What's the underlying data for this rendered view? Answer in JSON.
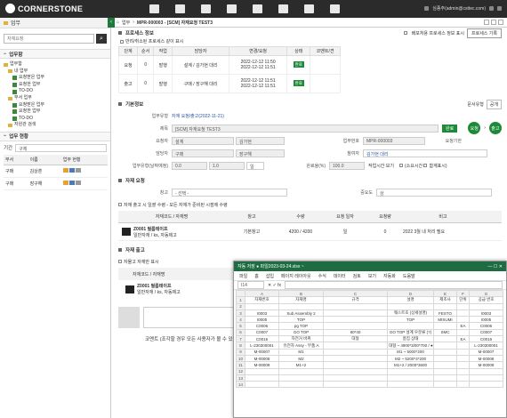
{
  "app": {
    "brand": "CORNERSTONE",
    "user": "심종주(admin@csttec.com)"
  },
  "left": {
    "title": "업무",
    "search_placeholder": "자재요청",
    "section1": "업무함",
    "tree": [
      "업무함",
      "내 업무",
      "요청받은 업무",
      "요청한 업무",
      "TO-DO",
      "부서 업무",
      "요청받은 업무",
      "요청한 업무",
      "TO-DO",
      "자원관 검색"
    ],
    "section2": "업무 현황",
    "filter_label": "기간",
    "filter_value": "구체",
    "col_dept": "부서",
    "col_name": "이름",
    "col_status": "업무 현황",
    "rows": [
      {
        "dept": "구매",
        "name": "김상훈"
      },
      {
        "dept": "구매",
        "name": "장구해"
      }
    ]
  },
  "main": {
    "crumb": "업무",
    "title": "MPR-000003 - [SCM] 자재요청 TEST3",
    "flow": {
      "title": "프로세스 정보",
      "opt": "반려/취소된 프로세스 같이 표시",
      "opt2": "배포처용 프로세스 정보 표시",
      "btn": "프로세스 기록",
      "cols": [
        "단계",
        "순서",
        "작업",
        "담당자",
        "변경/요청",
        "상태",
        "코멘트/견"
      ],
      "rows": [
        {
          "stage": "요청",
          "ord": "0",
          "task": "발행",
          "who": "설계 / 김가현 대리",
          "dates": [
            "2022-12-12 11:50",
            "2022-12-12 11:51"
          ],
          "status": "완료"
        },
        {
          "stage": "출고",
          "ord": "0",
          "task": "발행",
          "who": "구매 / 장구해 대리",
          "dates": [
            "2022-12-12 11:51",
            "2022-12-12 11:51"
          ],
          "status": "완료"
        }
      ]
    },
    "basic": {
      "title": "기본정보",
      "right_label": "문서유형",
      "right_val": "공개",
      "type_label": "업무유형",
      "type_val": "자재 요청/출고(2022-11-21)",
      "subject_label": "제목",
      "subject_val": "[SCM] 자재요청 TEST3",
      "btn": "완료",
      "c1": "요청",
      "c2": "출고",
      "req_label": "요청자",
      "req1": "설계",
      "req2": "김가현",
      "biz_label": "업무번호",
      "biz_val": "MPR-000003",
      "due_label": "요청기한",
      "mgr_label": "담당자",
      "mgr1": "구매",
      "mgr2": "장구해",
      "ref_label": "참여자",
      "ref_val": "김가현 대리",
      "eff_label": "업무유형(날짜예정)",
      "eff1": "0.0",
      "eff2": "1.0",
      "eff3": "일",
      "pct_label": "완료율(%)",
      "pct_val": "100.0",
      "pct_note": "작업시간 보기",
      "ck1": "(소요시간",
      "ck2": "합계표시)"
    },
    "req": {
      "title": "자재 요청",
      "wh_label": "창고",
      "wh_val": "- 선택 -",
      "pri_label": "중요도",
      "pri_val": "상",
      "note": "자재 출고 시 일괄 수령 - 모든 자재가 준비된 시점에 수령",
      "cols": [
        "자재코드 / 자재명",
        "창고",
        "수량",
        "요청 일자",
        "요청량",
        "비고"
      ],
      "item_code": "Z0001 필름테이프",
      "item_sub": "일반자재 / ks, 자동제고",
      "item_wh": "기본창고",
      "item_qty": "4200 / 4200",
      "item_day": "일",
      "item_amt": "0",
      "item_note": "2022 3월 내 처리 필요"
    },
    "out": {
      "title": "자재 출고",
      "opt": "자물고 자재만 표시",
      "cols": [
        "자재코드 / 자재명"
      ],
      "item_code": "Z0001 필름테이프",
      "item_sub": "일반자재 / ks, 자동제고",
      "comment": "코멘트 (조각할 경우 모든 사용자가 볼 수 있음)"
    }
  },
  "excel": {
    "title": "자동 저장  ●  파일2023-03-24.xlsx  ~",
    "menu": [
      "파일",
      "홈",
      "삽입",
      "페이지 레이아웃",
      "수식",
      "데이터",
      "검토",
      "보기",
      "자동화",
      "도움말"
    ],
    "cell": "I14",
    "cols": [
      "A",
      "B",
      "C",
      "D",
      "E",
      "F",
      "G"
    ],
    "rows": [
      [
        "1",
        "자재번호",
        "자재명",
        "규격",
        "설명",
        "제조사",
        "단위",
        "공급 번호"
      ],
      [
        "2",
        "",
        "",
        "",
        "",
        "",
        "",
        ""
      ],
      [
        "3",
        "I0003",
        "Sub Assembly 2",
        "",
        "웨스트호 (상세설명)",
        "FESTO",
        "",
        "I0003"
      ],
      [
        "4",
        "I0005",
        "TOP",
        "",
        "TOP",
        "MISUMI",
        "",
        "I0005"
      ],
      [
        "5",
        "C0006",
        "pg TOP",
        "",
        "",
        "",
        "EA",
        "C0006"
      ],
      [
        "6",
        "C0007",
        "GO TOP",
        "80*40",
        "GO TOP 설계 우분류 (?)",
        "SMC",
        "",
        "C0007"
      ],
      [
        "7",
        "C0016",
        "자전거 바퀴",
        "대형",
        "흠집 상태",
        "",
        "EA",
        "C0016"
      ],
      [
        "8",
        "L-230300001",
        "유전자 Assy - 부품 A",
        "",
        "대형 ~ 4900*3/00*700 / ● Sub Assy",
        "",
        "",
        "L-230300001"
      ],
      [
        "9",
        "M-00007",
        "M1",
        "",
        "M1 ~ 5000*200",
        "",
        "",
        "M-00007"
      ],
      [
        "10",
        "M-00008",
        "M2",
        "",
        "M2 ~ 5200*4*200",
        "",
        "",
        "M-00008"
      ],
      [
        "11",
        "M-00009",
        "M1+2",
        "",
        "M1+2 / 2000*3600",
        "",
        "",
        "M-00009"
      ],
      [
        "12",
        "",
        "",
        "",
        "",
        "",
        "",
        ""
      ],
      [
        "13",
        "",
        "",
        "",
        "",
        "",
        "",
        ""
      ],
      [
        "14",
        "",
        "",
        "",
        "",
        "",
        "",
        ""
      ]
    ]
  }
}
